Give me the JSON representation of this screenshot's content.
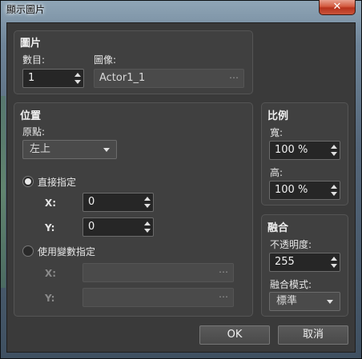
{
  "window": {
    "title": "顯示圖片",
    "close_label": "✕"
  },
  "picture_group": {
    "title": "圖片",
    "number_label": "數目:",
    "number_value": "1",
    "image_label": "圖像:",
    "image_value": "Actor1_1",
    "image_browse": "⋯"
  },
  "position_group": {
    "title": "位置",
    "origin_label": "原點:",
    "origin_value": "左上",
    "direct_label": "直接指定",
    "direct_x_label": "X:",
    "direct_x_value": "0",
    "direct_y_label": "Y:",
    "direct_y_value": "0",
    "variable_label": "使用變數指定",
    "var_x_label": "X:",
    "var_y_label": "Y:",
    "var_browse": "⋯",
    "selected_mode": "direct"
  },
  "scale_group": {
    "title": "比例",
    "width_label": "寬:",
    "width_value": "100 %",
    "height_label": "高:",
    "height_value": "100 %"
  },
  "blend_group": {
    "title": "融合",
    "opacity_label": "不透明度:",
    "opacity_value": "255",
    "mode_label": "融合模式:",
    "mode_value": "標準"
  },
  "buttons": {
    "ok": "OK",
    "cancel": "取消"
  }
}
